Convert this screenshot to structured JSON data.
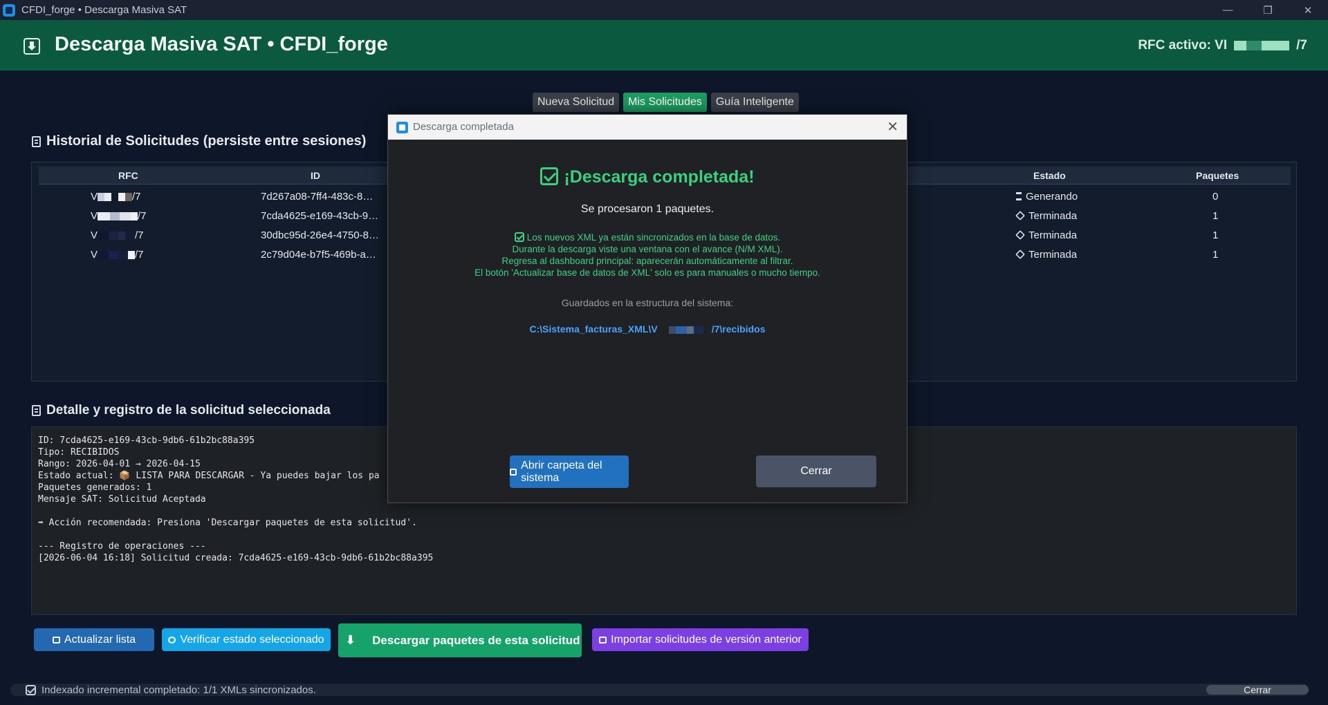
{
  "window": {
    "title": "CFDI_forge • Descarga Masiva SAT"
  },
  "header": {
    "title": "Descarga Masiva SAT  •  CFDI_forge",
    "rfc_prefix": "RFC activo: VI",
    "rfc_suffix": "/7"
  },
  "tabs": [
    {
      "label": "Nueva Solicitud",
      "active": false
    },
    {
      "label": "Mis Solicitudes",
      "active": true
    },
    {
      "label": "Guía Inteligente",
      "active": false
    }
  ],
  "history": {
    "title": "Historial de Solicitudes (persiste entre sesiones)",
    "columns": {
      "rfc": "RFC",
      "id": "ID",
      "estado": "Estado",
      "paquetes": "Paquetes"
    },
    "rows": [
      {
        "rfc_start": "V",
        "rfc_end": "/7",
        "id": "7d267a08-7ff4-483c-8…",
        "estado": "Generando",
        "estado_icon": "hourglass-icon",
        "paquetes": "0"
      },
      {
        "rfc_start": "V",
        "rfc_end": "/7",
        "id": "7cda4625-e169-43cb-9…",
        "estado": "Terminada",
        "estado_icon": "cube-icon",
        "paquetes": "1"
      },
      {
        "rfc_start": "V",
        "rfc_end": "/7",
        "id": "30dbc95d-26e4-4750-8…",
        "estado": "Terminada",
        "estado_icon": "cube-icon",
        "paquetes": "1"
      },
      {
        "rfc_start": "V",
        "rfc_end": "/7",
        "id": "2c79d04e-b7f5-469b-a…",
        "estado": "Terminada",
        "estado_icon": "cube-icon",
        "paquetes": "1"
      }
    ]
  },
  "detail": {
    "title": "Detalle y registro de la solicitud seleccionada",
    "text": "ID: 7cda4625-e169-43cb-9db6-61b2bc88a395\nTipo: RECIBIDOS\nRango: 2026-04-01 → 2026-04-15\nEstado actual: 📦 LISTA PARA DESCARGAR - Ya puedes bajar los pa\nPaquetes generados: 1\nMensaje SAT: Solicitud Aceptada\n\n➡ Acción recomendada: Presiona 'Descargar paquetes de esta solicitud'.\n\n--- Registro de operaciones ---\n[2026-06-04 16:18] Solicitud creada: 7cda4625-e169-43cb-9db6-61b2bc88a395"
  },
  "buttons": {
    "refresh": "Actualizar lista",
    "verify": "Verificar estado seleccionado",
    "download": "Descargar paquetes de esta solicitud",
    "import": "Importar solicitudes de versión anterior"
  },
  "status": {
    "text": "Indexado incremental completado: 1/1 XMLs sincronizados.",
    "close": "Cerrar"
  },
  "modal": {
    "window_title": "Descarga completada",
    "heading": "¡Descarga completada!",
    "subheading": "Se procesaron 1 paquetes.",
    "info_lines": [
      "Los nuevos XML ya están sincronizados en la base de datos.",
      "Durante la descarga viste una ventana con el avance (N/M XML).",
      "Regresa al dashboard principal: aparecerán automáticamente al filtrar.",
      "El botón 'Actualizar base de datos de XML' solo es para manuales o mucho tiempo."
    ],
    "saved_label": "Guardados en la estructura del sistema:",
    "path_prefix": "C:\\Sistema_facturas_XML\\V",
    "path_suffix": "/7\\recibidos",
    "open_button": "Abrir carpeta del sistema",
    "close_button": "Cerrar"
  },
  "colors": {
    "header_bg": "#0b5a3f",
    "accent_green": "#39d07e",
    "tab_active": "#1c9b62",
    "link_blue": "#4aa3ff"
  }
}
